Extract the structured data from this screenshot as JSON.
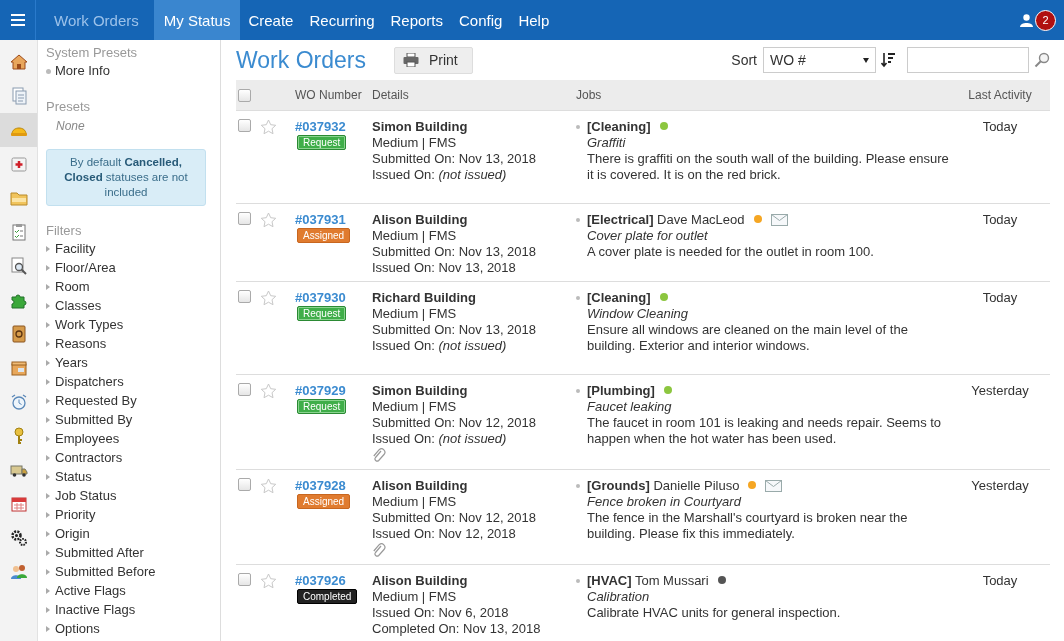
{
  "topbar": {
    "title": "Work Orders",
    "items": [
      {
        "label": "My Status",
        "selected": true
      },
      {
        "label": "Create",
        "selected": false
      },
      {
        "label": "Recurring",
        "selected": false
      },
      {
        "label": "Reports",
        "selected": false
      },
      {
        "label": "Config",
        "selected": false
      },
      {
        "label": "Help",
        "selected": false
      }
    ],
    "notification_count": "2"
  },
  "rail": [
    {
      "kind": "home",
      "selected": false
    },
    {
      "kind": "document",
      "selected": false
    },
    {
      "kind": "hardhat",
      "selected": true
    },
    {
      "kind": "firstaid",
      "selected": false
    },
    {
      "kind": "folder",
      "selected": false
    },
    {
      "kind": "clipboard",
      "selected": false
    },
    {
      "kind": "inspect",
      "selected": false
    },
    {
      "kind": "puzzle",
      "selected": false
    },
    {
      "kind": "contacts",
      "selected": false
    },
    {
      "kind": "package",
      "selected": false
    },
    {
      "kind": "alarm",
      "selected": false
    },
    {
      "kind": "key",
      "selected": false
    },
    {
      "kind": "truck",
      "selected": false
    },
    {
      "kind": "calendar",
      "selected": false
    },
    {
      "kind": "gears",
      "selected": false
    },
    {
      "kind": "people",
      "selected": false
    }
  ],
  "sidebar": {
    "system_presets": {
      "title": "System Presets",
      "items": [
        "More Info"
      ]
    },
    "presets": {
      "title": "Presets",
      "empty": "None"
    },
    "notice": "By default **Cancelled, Closed** statuses are not included",
    "filters": {
      "title": "Filters",
      "items": [
        "Facility",
        "Floor/Area",
        "Room",
        "Classes",
        "Work Types",
        "Reasons",
        "Years",
        "Dispatchers",
        "Requested By",
        "Submitted By",
        "Employees",
        "Contractors",
        "Status",
        "Job Status",
        "Priority",
        "Origin",
        "Submitted After",
        "Submitted Before",
        "Active Flags",
        "Inactive Flags",
        "Options"
      ]
    }
  },
  "main": {
    "title": "Work Orders",
    "print_button": "Print",
    "sort_label": "Sort",
    "sort_value": "WO #"
  },
  "table": {
    "select_all": {
      "checked": false
    },
    "columns": [
      "WO Number",
      "Details",
      "Jobs",
      "Last Activity"
    ],
    "rows": [
      {
        "checked": false,
        "starred": false,
        "number": "#037932",
        "status": {
          "label": "Request",
          "kind": "request"
        },
        "building": "Simon Building",
        "priority": "Medium | FMS",
        "dates": [
          "Submitted On: Nov 13, 2018",
          "Issued On: *(not issued)*"
        ],
        "attachment": false,
        "job": {
          "heading": "**[Cleaning]**",
          "color": "#8cc63f",
          "email": false,
          "title": "Graffiti",
          "description": "There is graffiti on the south wall of the building. Please ensure it is covered. It is on the red brick."
        },
        "last_activity": "Today"
      },
      {
        "checked": false,
        "starred": false,
        "number": "#037931",
        "status": {
          "label": "Assigned",
          "kind": "assigned"
        },
        "building": "Alison Building",
        "priority": "Medium | FMS",
        "dates": [
          "Submitted On: Nov 13, 2018",
          "Issued On: Nov 13, 2018"
        ],
        "attachment": false,
        "job": {
          "heading": "**[Electrical]** Dave MacLeod",
          "color": "#f5a623",
          "email": true,
          "title": "Cover plate for outlet",
          "description": "A cover plate is needed for the outlet in room 100."
        },
        "last_activity": "Today"
      },
      {
        "checked": false,
        "starred": false,
        "number": "#037930",
        "status": {
          "label": "Request",
          "kind": "request"
        },
        "building": "Richard Building",
        "priority": "Medium | FMS",
        "dates": [
          "Submitted On: Nov 13, 2018",
          "Issued On: *(not issued)*"
        ],
        "attachment": false,
        "job": {
          "heading": "**[Cleaning]**",
          "color": "#8cc63f",
          "email": false,
          "title": "Window Cleaning",
          "description": "Ensure all windows are cleaned on the main level of the building. Exterior and interior windows."
        },
        "last_activity": "Today"
      },
      {
        "checked": false,
        "starred": false,
        "number": "#037929",
        "status": {
          "label": "Request",
          "kind": "request"
        },
        "building": "Simon Building",
        "priority": "Medium | FMS",
        "dates": [
          "Submitted On: Nov 12, 2018",
          "Issued On: *(not issued)*"
        ],
        "attachment": true,
        "job": {
          "heading": "**[Plumbing]**",
          "color": "#8cc63f",
          "email": false,
          "title": "Faucet leaking",
          "description": "The faucet in room 101 is leaking and needs repair. Seems to happen when the hot water has been used."
        },
        "last_activity": "Yesterday"
      },
      {
        "checked": false,
        "starred": false,
        "number": "#037928",
        "status": {
          "label": "Assigned",
          "kind": "assigned"
        },
        "building": "Alison Building",
        "priority": "Medium | FMS",
        "dates": [
          "Submitted On: Nov 12, 2018",
          "Issued On: Nov 12, 2018"
        ],
        "attachment": true,
        "job": {
          "heading": "**[Grounds]** Danielle Piluso",
          "color": "#f5a623",
          "email": true,
          "title": "Fence broken in Courtyard",
          "description": "The fence in the Marshall's courtyard is broken near the building. Please fix this immediately."
        },
        "last_activity": "Yesterday"
      },
      {
        "checked": false,
        "starred": false,
        "number": "#037926",
        "status": {
          "label": "Completed",
          "kind": "completed"
        },
        "building": "Alison Building",
        "priority": "Medium | FMS",
        "dates": [
          "Issued On: Nov 6, 2018",
          "Completed On: Nov 13, 2018"
        ],
        "attachment": false,
        "job": {
          "heading": "**[HVAC]** Tom Mussari",
          "color": "#555555",
          "email": false,
          "title": "Calibration",
          "description": "Calibrate HVAC units for general inspection."
        },
        "last_activity": "Today"
      }
    ]
  }
}
